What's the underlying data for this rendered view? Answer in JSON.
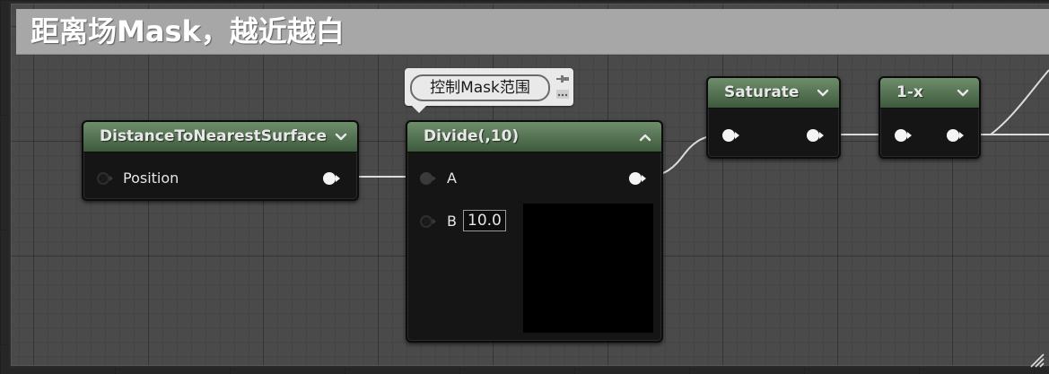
{
  "comment": {
    "title": "距离场Mask，越近越白"
  },
  "bubble": {
    "text": "控制Mask范围"
  },
  "nodes": {
    "distance": {
      "title": "DistanceToNearestSurface",
      "pins": {
        "position": "Position"
      }
    },
    "divide": {
      "title": "Divide(,10)",
      "pins": {
        "a": "A",
        "b": "B"
      },
      "b_value": "10.0"
    },
    "saturate": {
      "title": "Saturate"
    },
    "oneminus": {
      "title": "1-x"
    }
  },
  "colors": {
    "node_header": "#5b7b58",
    "comment_header": "#a7a7a7",
    "canvas": "#4a4a4a",
    "wire": "#e0e0e0"
  },
  "icons": {
    "chevron_down": "chevron-down-icon",
    "chevron_up": "chevron-up-icon",
    "pin": "pin-icon",
    "more": "dots-icon",
    "exec_pin": "pin-connector-icon",
    "resize": "resize-grip-icon"
  }
}
